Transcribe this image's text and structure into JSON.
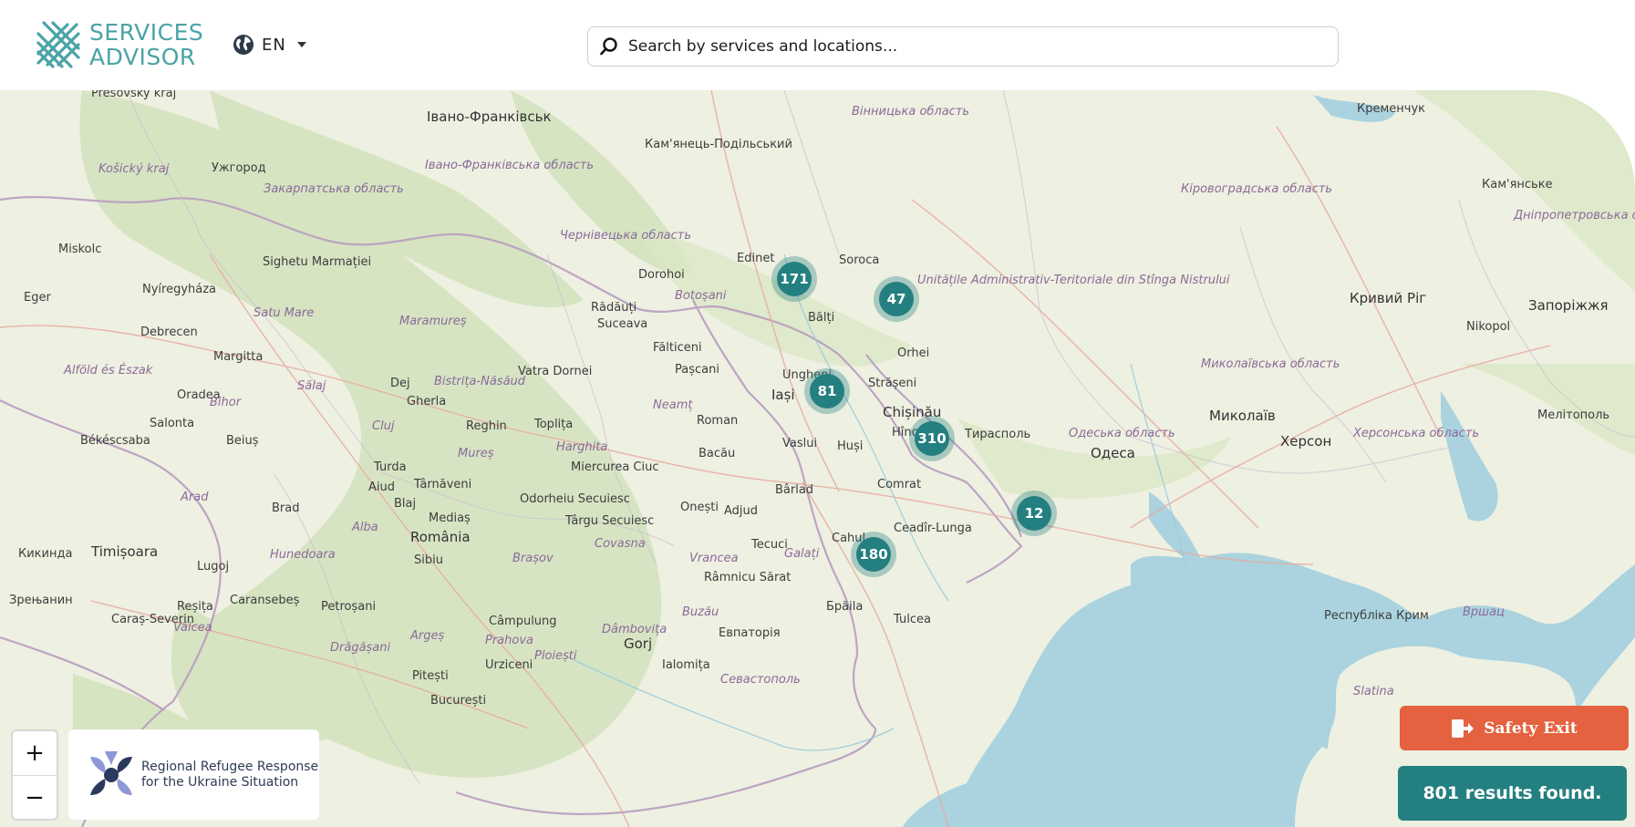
{
  "header": {
    "logo_line1": "SERVICES",
    "logo_line2": "ADVISOR",
    "language": "EN",
    "search_placeholder": "Search by services and locations..."
  },
  "map": {
    "clusters": [
      {
        "count": "171"
      },
      {
        "count": "47"
      },
      {
        "count": "81"
      },
      {
        "count": "310"
      },
      {
        "count": "12"
      },
      {
        "count": "180"
      }
    ],
    "places": [
      "Presovský kraj",
      "Івано-Франківськ",
      "Вінницька область",
      "Кременчук",
      "Košický kraj",
      "Ужгород",
      "Кам'янець-Подільський",
      "Івано-Франківська область",
      "Закарпатська область",
      "Кам'янське",
      "Кіровоградська область",
      "Дніпропетровська область",
      "Miskolc",
      "Sighetu Marmației",
      "Чернівецька область",
      "Edinet",
      "Soroca",
      "Eger",
      "Nyíregyháza",
      "Dorohoi",
      "Rădăuți",
      "Botoșani",
      "Unitățile Administrativ-Teritoriale din Stînga Nistrului",
      "Кривий Ріг",
      "Запоріжжя",
      "Debrecen",
      "Satu Mare",
      "Maramureș",
      "Suceava",
      "Bălți",
      "Nikopol",
      "Margitta",
      "Fălticeni",
      "Orhei",
      "Миколаївська область",
      "Alföld és Észak",
      "Vatra Dornei",
      "Pașcani",
      "Ungheni",
      "Iași",
      "Strășeni",
      "Oradea",
      "Dej",
      "Bistrița-Năsăud",
      "Sălaj",
      "Chișinău",
      "Hîncești",
      "Тирасполь",
      "Bihor",
      "Gherla",
      "Neamț",
      "Roman",
      "Миколаїв",
      "Херсон",
      "Мелітополь",
      "Salonta",
      "Reghin",
      "Toplița",
      "Harghita",
      "Vaslui",
      "Huși",
      "Одеська область",
      "Херсонська область",
      "Békéscsaba",
      "Beiuș",
      "Cluj",
      "Mureș",
      "Bacău",
      "Одеса",
      "Turda",
      "Aiud",
      "Târnăveni",
      "Miercurea Ciuc",
      "Comrat",
      "Arad",
      "Brad",
      "Blaj",
      "Odorheiu Secuiesc",
      "Onești",
      "Adjud",
      "Bârlad",
      "Alba",
      "Mediaș",
      "Târgu Secuiesc",
      "Cahul",
      "Ceadîr-Lunga",
      "Кикинда",
      "Timișoara",
      "România",
      "Covasna",
      "Tecuci",
      "Hunedoara",
      "Sibiu",
      "Brașov",
      "Vrancea",
      "Galați",
      "Lugoj",
      "Caransebeș",
      "Petroșani",
      "Râmnicu Sărat",
      "Брăila",
      "Tulcea",
      "Зрењанин",
      "Reșița",
      "Câmpulung",
      "Buzău",
      "Евпаторія",
      "Республіка Крим",
      "Вршац",
      "Caraș-Severin",
      "Vâlcea",
      "Argeș",
      "Prahova",
      "Dâmbovița",
      "Ploiești",
      "Gorj",
      "Drăgășani",
      "Pitești",
      "Urziceni",
      "Ialomița",
      "Севастополь",
      "Slatina",
      "București"
    ]
  },
  "controls": {
    "zoom_in": "+",
    "zoom_out": "−",
    "partner_line1": "Regional Refugee Response",
    "partner_line2": "for the Ukraine Situation",
    "safety_exit": "Safety Exit",
    "results": "801 results found."
  }
}
